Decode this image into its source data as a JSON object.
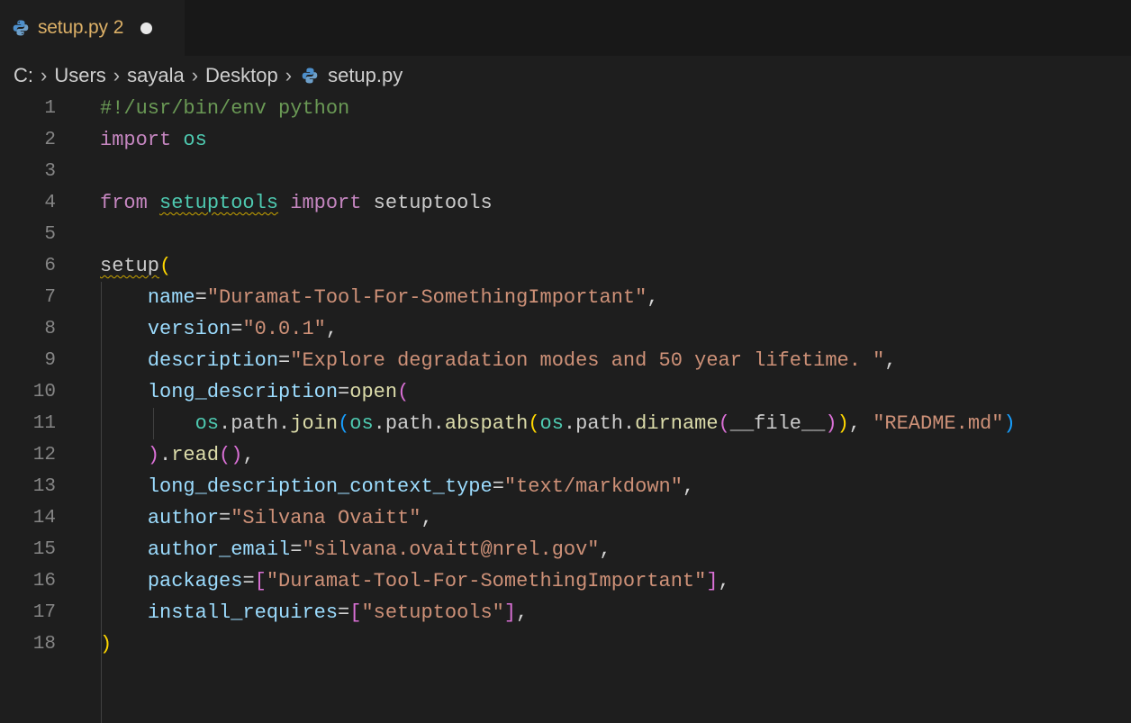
{
  "tab": {
    "label": "setup.py",
    "problem_count": "2",
    "icon": "python-icon"
  },
  "breadcrumb": [
    "C:",
    "Users",
    "sayala",
    "Desktop",
    "setup.py"
  ],
  "editor": {
    "line_numbers": [
      "1",
      "2",
      "3",
      "4",
      "5",
      "6",
      "7",
      "8",
      "9",
      "10",
      "11",
      "12",
      "13",
      "14",
      "15",
      "16",
      "17",
      "18"
    ],
    "lines": [
      [
        {
          "t": "#!/usr/bin/env python",
          "c": "c-comment"
        }
      ],
      [
        {
          "t": "import",
          "c": "c-kw"
        },
        {
          "t": " ",
          "c": "c-id"
        },
        {
          "t": "os",
          "c": "c-mod"
        }
      ],
      [],
      [
        {
          "t": "from",
          "c": "c-kw"
        },
        {
          "t": " ",
          "c": "c-id"
        },
        {
          "t": "setuptools",
          "c": "c-mod squiggle"
        },
        {
          "t": " ",
          "c": "c-id"
        },
        {
          "t": "import",
          "c": "c-kw"
        },
        {
          "t": " setuptools",
          "c": "c-id"
        }
      ],
      [],
      [
        {
          "t": "setup",
          "c": "c-id squiggle"
        },
        {
          "t": "(",
          "c": "c-br1"
        }
      ],
      [
        {
          "t": "    ",
          "c": "c-id"
        },
        {
          "t": "name",
          "c": "c-param"
        },
        {
          "t": "=",
          "c": "c-punc"
        },
        {
          "t": "\"Duramat-Tool-For-SomethingImportant\"",
          "c": "c-str"
        },
        {
          "t": ",",
          "c": "c-punc"
        }
      ],
      [
        {
          "t": "    ",
          "c": "c-id"
        },
        {
          "t": "version",
          "c": "c-param"
        },
        {
          "t": "=",
          "c": "c-punc"
        },
        {
          "t": "\"0.0.1\"",
          "c": "c-str"
        },
        {
          "t": ",",
          "c": "c-punc"
        }
      ],
      [
        {
          "t": "    ",
          "c": "c-id"
        },
        {
          "t": "description",
          "c": "c-param"
        },
        {
          "t": "=",
          "c": "c-punc"
        },
        {
          "t": "\"Explore degradation modes and 50 year lifetime. \"",
          "c": "c-str"
        },
        {
          "t": ",",
          "c": "c-punc"
        }
      ],
      [
        {
          "t": "    ",
          "c": "c-id"
        },
        {
          "t": "long_description",
          "c": "c-param"
        },
        {
          "t": "=",
          "c": "c-punc"
        },
        {
          "t": "open",
          "c": "c-func"
        },
        {
          "t": "(",
          "c": "c-br2"
        }
      ],
      [
        {
          "t": "        ",
          "c": "c-id"
        },
        {
          "t": "os",
          "c": "c-mod"
        },
        {
          "t": ".path.",
          "c": "c-id"
        },
        {
          "t": "join",
          "c": "c-func"
        },
        {
          "t": "(",
          "c": "c-br3"
        },
        {
          "t": "os",
          "c": "c-mod"
        },
        {
          "t": ".path.",
          "c": "c-id"
        },
        {
          "t": "abspath",
          "c": "c-func"
        },
        {
          "t": "(",
          "c": "c-br1"
        },
        {
          "t": "os",
          "c": "c-mod"
        },
        {
          "t": ".path.",
          "c": "c-id"
        },
        {
          "t": "dirname",
          "c": "c-func"
        },
        {
          "t": "(",
          "c": "c-br2"
        },
        {
          "t": "__file__",
          "c": "c-id"
        },
        {
          "t": ")",
          "c": "c-br2"
        },
        {
          "t": ")",
          "c": "c-br1"
        },
        {
          "t": ", ",
          "c": "c-punc"
        },
        {
          "t": "\"README.md\"",
          "c": "c-str"
        },
        {
          "t": ")",
          "c": "c-br3"
        }
      ],
      [
        {
          "t": "    ",
          "c": "c-id"
        },
        {
          "t": ")",
          "c": "c-br2"
        },
        {
          "t": ".",
          "c": "c-punc"
        },
        {
          "t": "read",
          "c": "c-func"
        },
        {
          "t": "()",
          "c": "c-br2"
        },
        {
          "t": ",",
          "c": "c-punc"
        }
      ],
      [
        {
          "t": "    ",
          "c": "c-id"
        },
        {
          "t": "long_description_context_type",
          "c": "c-param"
        },
        {
          "t": "=",
          "c": "c-punc"
        },
        {
          "t": "\"text/markdown\"",
          "c": "c-str"
        },
        {
          "t": ",",
          "c": "c-punc"
        }
      ],
      [
        {
          "t": "    ",
          "c": "c-id"
        },
        {
          "t": "author",
          "c": "c-param"
        },
        {
          "t": "=",
          "c": "c-punc"
        },
        {
          "t": "\"Silvana Ovaitt\"",
          "c": "c-str"
        },
        {
          "t": ",",
          "c": "c-punc"
        }
      ],
      [
        {
          "t": "    ",
          "c": "c-id"
        },
        {
          "t": "author_email",
          "c": "c-param"
        },
        {
          "t": "=",
          "c": "c-punc"
        },
        {
          "t": "\"silvana.ovaitt@nrel.gov\"",
          "c": "c-str"
        },
        {
          "t": ",",
          "c": "c-punc"
        }
      ],
      [
        {
          "t": "    ",
          "c": "c-id"
        },
        {
          "t": "packages",
          "c": "c-param"
        },
        {
          "t": "=",
          "c": "c-punc"
        },
        {
          "t": "[",
          "c": "c-br2"
        },
        {
          "t": "\"Duramat-Tool-For-SomethingImportant\"",
          "c": "c-str"
        },
        {
          "t": "]",
          "c": "c-br2"
        },
        {
          "t": ",",
          "c": "c-punc"
        }
      ],
      [
        {
          "t": "    ",
          "c": "c-id"
        },
        {
          "t": "install_requires",
          "c": "c-param"
        },
        {
          "t": "=",
          "c": "c-punc"
        },
        {
          "t": "[",
          "c": "c-br2"
        },
        {
          "t": "\"setuptools\"",
          "c": "c-str"
        },
        {
          "t": "]",
          "c": "c-br2"
        },
        {
          "t": ",",
          "c": "c-punc"
        }
      ],
      [
        {
          "t": ")",
          "c": "c-br1"
        }
      ]
    ]
  },
  "colors": {
    "background": "#1e1e1e",
    "tab_label": "#dcb067",
    "string": "#ce9178",
    "keyword": "#c586c0",
    "parameter": "#9cdcfe",
    "function": "#dcdcaa",
    "comment": "#6a9955",
    "module": "#4ec9b0"
  }
}
